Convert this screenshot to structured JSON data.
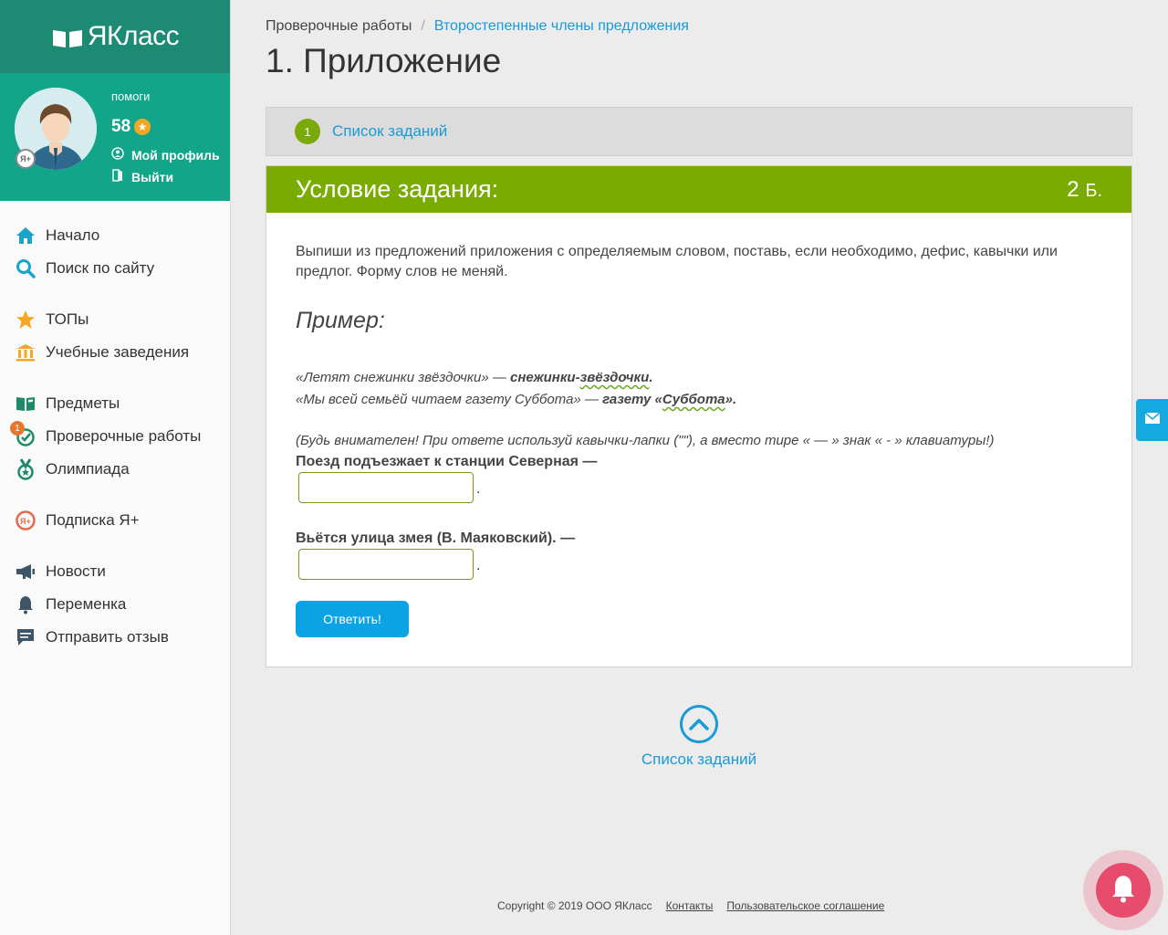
{
  "brand": {
    "logo_text": "ЯКласс"
  },
  "profile": {
    "name": "помоги",
    "points": "58",
    "my_profile": "Мой профиль",
    "logout": "Выйти",
    "badge": "Я+"
  },
  "nav": {
    "home": "Начало",
    "search": "Поиск по сайту",
    "tops": "ТОПы",
    "schools": "Учебные заведения",
    "subjects": "Предметы",
    "tests": "Проверочные работы",
    "tests_badge": "1",
    "olympiad": "Олимпиада",
    "subscription": "Подписка Я+",
    "news": "Новости",
    "break": "Переменка",
    "feedback": "Отправить отзыв"
  },
  "breadcrumb": {
    "root": "Проверочные работы",
    "sep": "/",
    "current": "Второстепенные члены предложения"
  },
  "page_title": "1. Приложение",
  "task_list_bar": {
    "number": "1",
    "label": "Список заданий"
  },
  "task": {
    "header": "Условие задания:",
    "points": "2",
    "points_unit": "Б.",
    "instruction": "Выпиши из предложений приложения с определяемым словом, поставь, если необходимо, дефис, кавычки или предлог. Форму слов не меняй.",
    "example_heading": "Пример:",
    "ex1_q": "«Летят снежинки звёздочки» — ",
    "ex1_a1": "снежинки-",
    "ex1_a2": "звёздочки",
    "ex1_a3": ".",
    "ex2_q": "«Мы всей семьёй читаем газету Суббота» — ",
    "ex2_a1": "газету «",
    "ex2_a2": "Суббота",
    "ex2_a3": "».",
    "note": "(Будь внимателен! При ответе используй кавычки-лапки (\"\"), а вместо тире « — » знак « - » клавиатуры!)",
    "q1": "Поезд подъезжает к станции Северная —",
    "q1_value": "",
    "q2": "Вьётся улица змея (В. Маяковский). —",
    "q2_value": "",
    "period": ".",
    "answer_button": "Ответить!"
  },
  "back_to_list": "Список заданий",
  "footer": {
    "copyright": "Copyright © 2019 ООО ЯКласс",
    "contacts": "Контакты",
    "agreement": "Пользовательское соглашение"
  },
  "colors": {
    "brand_dark": "#1d8a74",
    "brand": "#12a58a",
    "task_header": "#7aab00",
    "link": "#1a9ad6",
    "button": "#0ca3e5",
    "bell": "#e84c6c"
  },
  "icons": {
    "logo": "book-icon",
    "home": "house-icon",
    "search": "magnifier-icon",
    "tops": "star-icon",
    "schools": "building-icon",
    "subjects": "books-icon",
    "tests": "check-circle-icon",
    "olympiad": "medal-icon",
    "subscription": "ya-plus-icon",
    "news": "megaphone-icon",
    "break": "bell-icon",
    "feedback": "chat-icon",
    "mail": "envelope-icon",
    "notifications": "bell-icon"
  }
}
